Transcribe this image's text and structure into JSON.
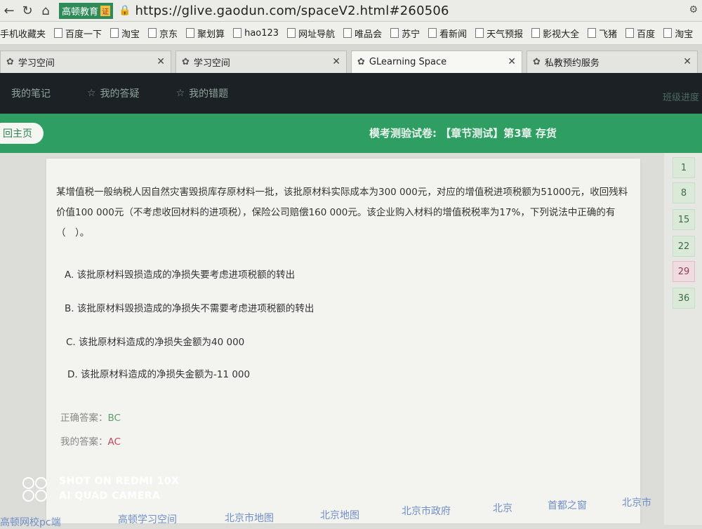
{
  "browser": {
    "site_tag": "高顿教育",
    "site_cert": "证",
    "url": "https://glive.gaodun.com/spaceV2.html#260506"
  },
  "bookmarks": [
    "手机收藏夹",
    "百度一下",
    "淘宝",
    "京东",
    "聚划算",
    "hao123",
    "网址导航",
    "唯品会",
    "苏宁",
    "看新闻",
    "天气预报",
    "影视大全",
    "飞猪",
    "百度",
    "淘宝"
  ],
  "tabs": [
    {
      "label": "学习空间",
      "active": false
    },
    {
      "label": "学习空间",
      "active": false
    },
    {
      "label": "GLearning Space",
      "active": true
    },
    {
      "label": "私教预约服务",
      "active": false
    }
  ],
  "topnav": {
    "items": [
      "我的笔记",
      "我的答疑",
      "我的错题"
    ],
    "right": "班级进度"
  },
  "header": {
    "back_label": "回主页",
    "title": "模考测验试卷: 【章节测试】第3章 存货"
  },
  "question": {
    "text": "某增值税一般纳税人因自然灾害毁损库存原材料一批，该批原材料实际成本为300 000元，对应的增值税进项税额为51000元，收回残料价值100 000元（不考虑收回材料的进项税），保险公司赔偿160 000元。该企业购入材料的增值税税率为17%，下列说法中正确的有（　）。",
    "options": [
      "A. 该批原材料毁损造成的净损失要考虑进项税额的转出",
      "B. 该批原材料毁损造成的净损失不需要考虑进项税额的转出",
      "C. 该批原材料造成的净损失金额为40 000",
      "D. 该批原材料造成的净损失金额为-11 000"
    ],
    "correct_label": "正确答案：",
    "correct_value": "BC",
    "my_label": "我的答案：",
    "my_value": "AC"
  },
  "question_numbers": [
    "1",
    "8",
    "15",
    "22",
    "29",
    "36"
  ],
  "footer_links": [
    "高顿网校pc端",
    "高顿学习空间",
    "北京市地图",
    "北京地图",
    "北京市政府",
    "北京",
    "首都之窗",
    "北京市"
  ],
  "watermark": {
    "line1": "SHOT ON REDMI 10X",
    "line2": "AI QUAD CAMERA"
  }
}
